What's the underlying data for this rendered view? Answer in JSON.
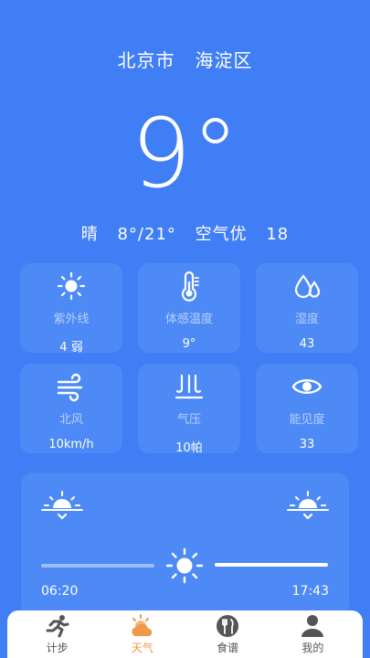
{
  "location": {
    "city": "北京市",
    "district": "海淀区"
  },
  "current": {
    "temperature": "9°"
  },
  "summary": {
    "condition": "晴",
    "range": "8°/21°",
    "air_label": "空气优",
    "aqi": "18"
  },
  "tiles": [
    {
      "icon": "sun-icon",
      "label": "紫外线",
      "value": "4 弱"
    },
    {
      "icon": "thermometer-icon",
      "label": "体感温度",
      "value": "9°"
    },
    {
      "icon": "humidity-drops-icon",
      "label": "湿度",
      "value": "43"
    },
    {
      "icon": "wind-icon",
      "label": "北风",
      "value": "10km/h"
    },
    {
      "icon": "pressure-icon",
      "label": "气压",
      "value": "10帕"
    },
    {
      "icon": "eye-icon",
      "label": "能见度",
      "value": "33"
    }
  ],
  "sun": {
    "sunrise": "06:20",
    "sunset": "17:43",
    "day_progress": 0.5
  },
  "tabs": [
    {
      "icon": "running-icon",
      "label": "计步",
      "active": false
    },
    {
      "icon": "weather-icon",
      "label": "天气",
      "active": true
    },
    {
      "icon": "recipe-icon",
      "label": "食谱",
      "active": false
    },
    {
      "icon": "user-icon",
      "label": "我的",
      "active": false
    }
  ],
  "colors": {
    "background": "#3f7ef4",
    "tile": "#4d8af6",
    "tab_active": "#f0994a",
    "tab_inactive": "#555555"
  }
}
